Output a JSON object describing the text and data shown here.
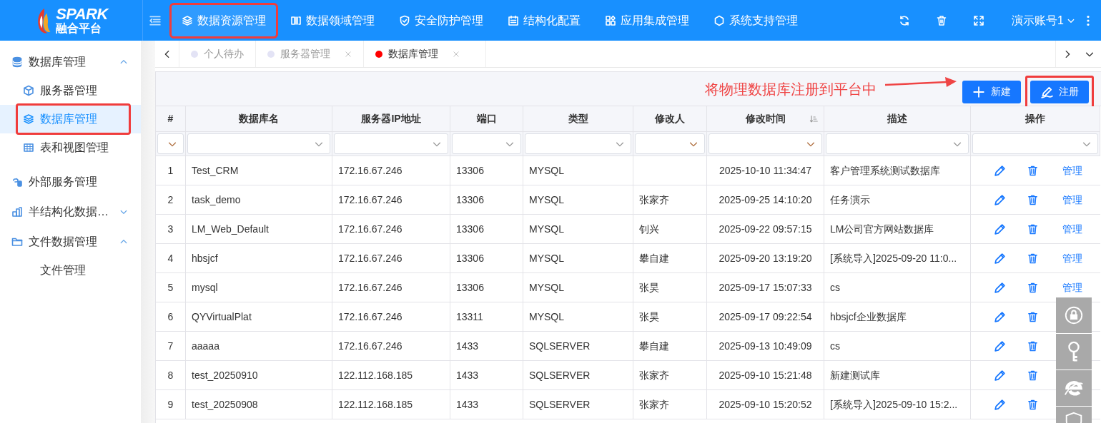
{
  "logo": {
    "title": "SPARK",
    "subtitle": "融合平台"
  },
  "top_nav": [
    {
      "label": "数据资源管理",
      "selected": true,
      "highlighted": true
    },
    {
      "label": "数据领域管理",
      "selected": false,
      "highlighted": false
    },
    {
      "label": "安全防护管理",
      "selected": false,
      "highlighted": false
    },
    {
      "label": "结构化配置",
      "selected": false,
      "highlighted": false
    },
    {
      "label": "应用集成管理",
      "selected": false,
      "highlighted": false
    },
    {
      "label": "系统支持管理",
      "selected": false,
      "highlighted": false
    }
  ],
  "user": {
    "name": "演示账号1"
  },
  "sidebar": {
    "items": [
      {
        "label": "数据库管理",
        "expanded": true,
        "selected": false,
        "highlighted": false,
        "children": [
          {
            "label": "服务器管理",
            "selected": false,
            "highlighted": false
          },
          {
            "label": "数据库管理",
            "selected": true,
            "highlighted": true
          },
          {
            "label": "表和视图管理",
            "selected": false,
            "highlighted": false
          }
        ]
      },
      {
        "label": "外部服务管理",
        "selected": false,
        "highlighted": false
      },
      {
        "label": "半结构化数据…",
        "expanded": false,
        "selected": false,
        "highlighted": false
      },
      {
        "label": "文件数据管理",
        "expanded": true,
        "selected": false,
        "highlighted": false,
        "children": [
          {
            "label": "文件管理",
            "selected": false,
            "highlighted": false
          }
        ]
      }
    ]
  },
  "tabs": [
    {
      "label": "个人待办",
      "selected": false,
      "closable": false
    },
    {
      "label": "服务器管理",
      "selected": false,
      "closable": true
    },
    {
      "label": "数据库管理",
      "selected": true,
      "closable": true
    }
  ],
  "annotation": {
    "text": "将物理数据库注册到平台中"
  },
  "toolbar": [
    {
      "label": "新建",
      "highlighted": false
    },
    {
      "label": "注册",
      "highlighted": true
    }
  ],
  "table": {
    "columns": [
      {
        "label": "#",
        "sorted": false
      },
      {
        "label": "数据库名",
        "sorted": false
      },
      {
        "label": "服务器IP地址",
        "sorted": false
      },
      {
        "label": "端口",
        "sorted": false
      },
      {
        "label": "类型",
        "sorted": false
      },
      {
        "label": "修改人",
        "sorted": false
      },
      {
        "label": "修改时间",
        "sorted": true
      },
      {
        "label": "描述",
        "sorted": false
      },
      {
        "label": "操作",
        "sorted": false
      }
    ],
    "rows": [
      {
        "cells": [
          "1",
          "Test_CRM",
          "172.16.67.246",
          "13306",
          "MYSQL",
          "",
          "2025-10-10 11:34:47",
          "客户管理系统测试数据库"
        ],
        "manage": "管理"
      },
      {
        "cells": [
          "2",
          "task_demo",
          "172.16.67.246",
          "13306",
          "MYSQL",
          "张家齐",
          "2025-09-25 14:10:20",
          "任务演示"
        ],
        "manage": "管理"
      },
      {
        "cells": [
          "3",
          "LM_Web_Default",
          "172.16.67.246",
          "13306",
          "MYSQL",
          "钊兴",
          "2025-09-22 09:57:15",
          "LM公司官方网站数据库"
        ],
        "manage": "管理"
      },
      {
        "cells": [
          "4",
          "hbsjcf",
          "172.16.67.246",
          "13306",
          "MYSQL",
          "攀自建",
          "2025-09-20 13:19:20",
          "[系统导入]2025-09-20 11:0..."
        ],
        "manage": "管理"
      },
      {
        "cells": [
          "5",
          "mysql",
          "172.16.67.246",
          "13306",
          "MYSQL",
          "张昊",
          "2025-09-17 15:07:33",
          "cs"
        ],
        "manage": "管理"
      },
      {
        "cells": [
          "6",
          "QYVirtualPlat",
          "172.16.67.246",
          "13311",
          "MYSQL",
          "张昊",
          "2025-09-17 09:22:54",
          "hbsjcf企业数据库"
        ]
      },
      {
        "cells": [
          "7",
          "aaaaa",
          "172.16.67.246",
          "1433",
          "SQLSERVER",
          "攀自建",
          "2025-09-13 10:49:09",
          "cs"
        ]
      },
      {
        "cells": [
          "8",
          "test_20250910",
          "122.112.168.185",
          "1433",
          "SQLSERVER",
          "张家齐",
          "2025-09-10 15:21:48",
          "新建测试库"
        ]
      },
      {
        "cells": [
          "9",
          "test_20250908",
          "122.112.168.185",
          "1433",
          "SQLSERVER",
          "张家齐",
          "2025-09-10 15:20:52",
          "[系统导入]2025-09-10 15:2..."
        ]
      }
    ]
  }
}
